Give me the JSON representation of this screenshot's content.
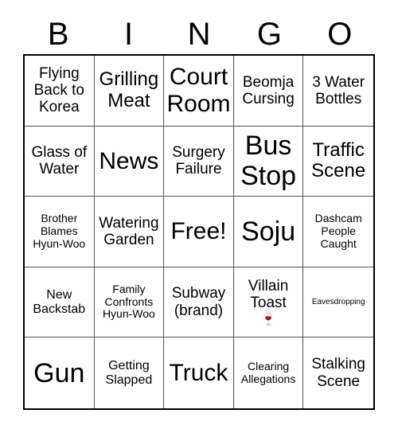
{
  "card": {
    "title": "BINGO",
    "header_letters": [
      "B",
      "I",
      "N",
      "G",
      "O"
    ],
    "free_space": "Free!",
    "grid_border_color": "#000000",
    "cell_border_color": "#555555",
    "background_color": "#ffffff",
    "text_color": "#000000"
  },
  "cells": [
    [
      {
        "label": "Flying Back to Korea",
        "size": "fs-m",
        "emoji": ""
      },
      {
        "label": "Grilling Meat",
        "size": "fs-l",
        "emoji": ""
      },
      {
        "label": "Court Room",
        "size": "fs-xl",
        "emoji": ""
      },
      {
        "label": "Beomja Cursing",
        "size": "fs-m",
        "emoji": ""
      },
      {
        "label": "3 Water Bottles",
        "size": "fs-m",
        "emoji": ""
      }
    ],
    [
      {
        "label": "Glass of Water",
        "size": "fs-m",
        "emoji": ""
      },
      {
        "label": "News",
        "size": "fs-xl",
        "emoji": ""
      },
      {
        "label": "Surgery Failure",
        "size": "fs-m",
        "emoji": ""
      },
      {
        "label": "Bus Stop",
        "size": "fs-xxl",
        "emoji": ""
      },
      {
        "label": "Traffic Scene",
        "size": "fs-l",
        "emoji": ""
      }
    ],
    [
      {
        "label": "Brother Blames Hyun-Woo",
        "size": "fs-xs",
        "emoji": ""
      },
      {
        "label": "Watering Garden",
        "size": "fs-m",
        "emoji": ""
      },
      {
        "label": "Free!",
        "size": "fs-xl",
        "emoji": ""
      },
      {
        "label": "Soju",
        "size": "fs-xxl",
        "emoji": ""
      },
      {
        "label": "Dashcam People Caught",
        "size": "fs-xs",
        "emoji": ""
      }
    ],
    [
      {
        "label": "New Backstab",
        "size": "fs-s",
        "emoji": ""
      },
      {
        "label": "Family Confronts Hyun-Woo",
        "size": "fs-xs",
        "emoji": ""
      },
      {
        "label": "Subway (brand)",
        "size": "fs-m",
        "emoji": ""
      },
      {
        "label": "Villain Toast",
        "size": "fs-m",
        "emoji": "🍷"
      },
      {
        "label": "Eavesdropping",
        "size": "fs-xxs",
        "emoji": ""
      }
    ],
    [
      {
        "label": "Gun",
        "size": "fs-xxl",
        "emoji": ""
      },
      {
        "label": "Getting Slapped",
        "size": "fs-s",
        "emoji": ""
      },
      {
        "label": "Truck",
        "size": "fs-xl",
        "emoji": ""
      },
      {
        "label": "Clearing Allegations",
        "size": "fs-xs",
        "emoji": ""
      },
      {
        "label": "Stalking Scene",
        "size": "fs-m",
        "emoji": ""
      }
    ]
  ]
}
